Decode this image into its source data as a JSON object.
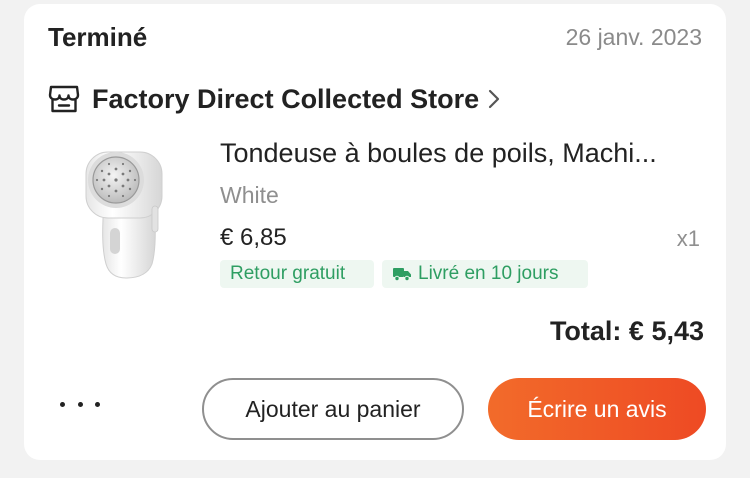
{
  "order": {
    "status": "Terminé",
    "date": "26 janv. 2023"
  },
  "store": {
    "name": "Factory Direct Collected Store",
    "icon": "store-icon"
  },
  "product": {
    "title": "Tondeuse à boules de poils, Machi...",
    "variant": "White",
    "price": "€ 6,85",
    "quantity": "x1",
    "image": "lint-remover-image"
  },
  "tags": {
    "free_return": "Retour gratuit",
    "delivery": "Livré en 10 jours",
    "color": "#2e9e62"
  },
  "total": "Total: € 5,43",
  "actions": {
    "more_icon": "more-dots-icon",
    "add_to_cart": "Ajouter au panier",
    "write_review": "Écrire un avis",
    "accent_color": "#ee4a24"
  }
}
